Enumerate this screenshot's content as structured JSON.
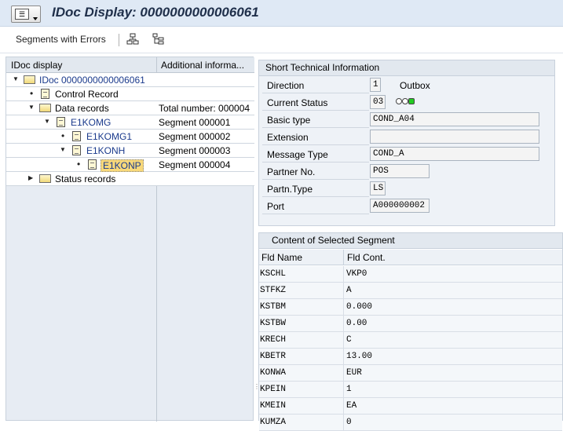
{
  "title": "IDoc Display: 0000000000006061",
  "toolbar": {
    "segments_with_errors": "Segments with Errors",
    "icon1": "hierarchy-icon",
    "icon2": "tree-structure-icon"
  },
  "tree": {
    "col1": "IDoc display",
    "col2": "Additional informa...",
    "rows": [
      {
        "label": "IDoc 0000000000006061",
        "add": ""
      },
      {
        "label": "Control Record",
        "add": ""
      },
      {
        "label": "Data records",
        "add": "Total number: 000004"
      },
      {
        "label": "E1KOMG",
        "add": "Segment 000001"
      },
      {
        "label": "E1KOMG1",
        "add": "Segment 000002"
      },
      {
        "label": "E1KONH",
        "add": "Segment 000003"
      },
      {
        "label": "E1KONP",
        "add": "Segment 000004"
      },
      {
        "label": "Status records",
        "add": ""
      }
    ]
  },
  "tech": {
    "title": "Short Technical Information",
    "direction_label": "Direction",
    "direction_value": "1",
    "direction_text": "Outbox",
    "status_label": "Current Status",
    "status_value": "03",
    "basic_type_label": "Basic type",
    "basic_type_value": "COND_A04",
    "extension_label": "Extension",
    "extension_value": "",
    "message_type_label": "Message Type",
    "message_type_value": "COND_A",
    "partner_no_label": "Partner No.",
    "partner_no_value": "POS",
    "partn_type_label": "Partn.Type",
    "partn_type_value": "LS",
    "port_label": "Port",
    "port_value": "A000000002"
  },
  "segment": {
    "title": "Content of Selected Segment",
    "col1": "Fld Name",
    "col2": "Fld Cont.",
    "rows": [
      {
        "name": "KSCHL",
        "value": "VKP0"
      },
      {
        "name": "STFKZ",
        "value": "A"
      },
      {
        "name": "KSTBM",
        "value": "0.000"
      },
      {
        "name": "KSTBW",
        "value": "0.00"
      },
      {
        "name": "KRECH",
        "value": "C"
      },
      {
        "name": "KBETR",
        "value": "13.00"
      },
      {
        "name": "KONWA",
        "value": "EUR"
      },
      {
        "name": "KPEIN",
        "value": "1"
      },
      {
        "name": "KMEIN",
        "value": "EA"
      },
      {
        "name": "KUMZA",
        "value": "0"
      }
    ]
  },
  "colors": {
    "status_green": "#22cc22",
    "header_bg": "#dfe9f5",
    "pane_bg": "#e7ecf3",
    "selected_highlight": "#f8d87a"
  }
}
